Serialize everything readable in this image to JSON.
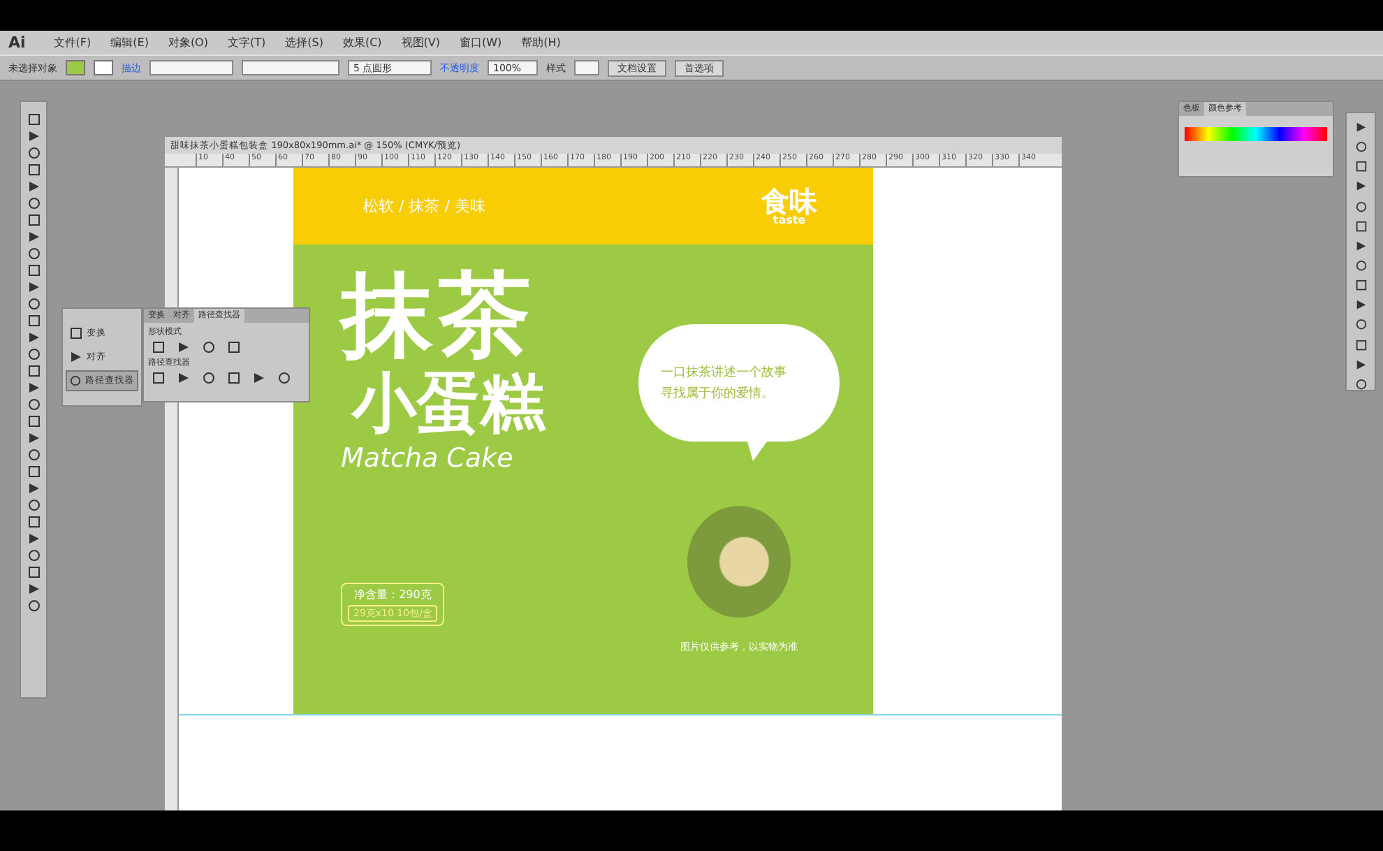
{
  "app": {
    "logo": "Ai",
    "menu": [
      "文件(F)",
      "编辑(E)",
      "对象(O)",
      "文字(T)",
      "选择(S)",
      "效果(C)",
      "视图(V)",
      "窗口(W)",
      "帮助(H)"
    ]
  },
  "control_bar": {
    "selection": "未选择对象",
    "stroke_label": "描边",
    "brush": "5 点圆形",
    "opacity_label": "不透明度",
    "opacity": "100%",
    "style_label": "样式",
    "buttons": [
      "文档设置",
      "首选项"
    ]
  },
  "document": {
    "tab_title": "甜味抹茶小蛋糕包装盒 190x80x190mm.ai* @ 150% (CMYK/预览)",
    "ruler_ticks": [
      "10",
      "40",
      "50",
      "60",
      "70",
      "80",
      "90",
      "100",
      "110",
      "120",
      "130",
      "140",
      "150",
      "160",
      "170",
      "180",
      "190",
      "200",
      "210",
      "220",
      "230",
      "240",
      "250",
      "260",
      "270",
      "280",
      "290",
      "300",
      "310",
      "320",
      "330",
      "340"
    ]
  },
  "artboard": {
    "tagline": "松软 / 抹茶 / 美味",
    "logo": {
      "text": "食味",
      "sub": "taste"
    },
    "title_line_1": "抹茶",
    "title_line_2": "小蛋糕",
    "title_en": "Matcha Cake",
    "bubble_lines": [
      "一口抹茶讲述一个故事",
      "寻找属于你的爱情。"
    ],
    "net_content": "净含量：290克",
    "pack": "29克x10 10包/盒",
    "caption": "图片仅供参考，以实物为准"
  },
  "floating_panel": {
    "items": [
      {
        "label": "变换",
        "selected": false
      },
      {
        "label": "对齐",
        "selected": false
      },
      {
        "label": "路径查找器",
        "selected": true
      }
    ],
    "tabs": [
      {
        "label": "变换",
        "selected": false
      },
      {
        "label": "对齐",
        "selected": false
      },
      {
        "label": "路径查找器",
        "selected": true
      }
    ],
    "sections": [
      "形状模式",
      "路径查找器"
    ]
  },
  "swatch_panel": {
    "tabs": [
      {
        "label": "色板",
        "selected": false
      },
      {
        "label": "颜色参考",
        "selected": true
      }
    ]
  }
}
